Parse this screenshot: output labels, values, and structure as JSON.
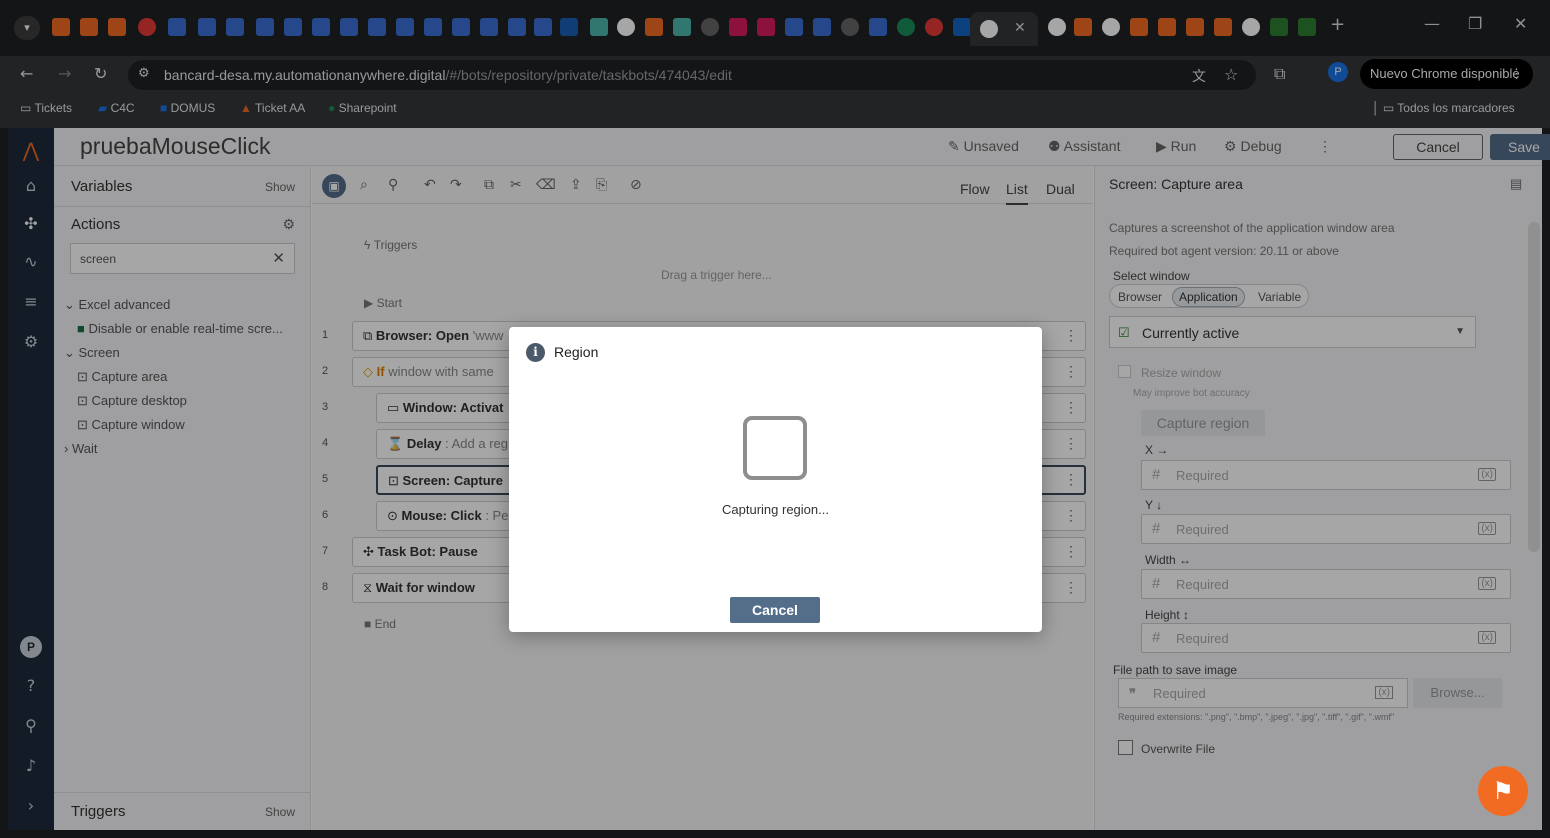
{
  "browser": {
    "url_host": "bancard-desa.my.automationanywhere.digital",
    "url_path": "/#/bots/repository/private/taskbots/474043/edit",
    "update_label": "Nuevo Chrome disponible",
    "bookmarks": [
      "Tickets",
      "C4C",
      "DOMUS",
      "Ticket AA",
      "Sharepoint"
    ],
    "all_bookmarks": "Todos los marcadores"
  },
  "header": {
    "title": "pruebaMouseClick",
    "unsaved": "Unsaved",
    "assistant": "Assistant",
    "run": "Run",
    "debug": "Debug",
    "cancel": "Cancel",
    "save": "Save"
  },
  "palette": {
    "variables": "Variables",
    "show": "Show",
    "actions": "Actions",
    "search_value": "screen",
    "tree": [
      "Excel advanced",
      "Disable or enable real-time scre...",
      "Screen",
      "Capture area",
      "Capture desktop",
      "Capture window",
      "Wait"
    ],
    "triggers": "Triggers"
  },
  "canvas": {
    "views": [
      "Flow",
      "List",
      "Dual"
    ],
    "triggers": "Triggers",
    "drag_hint": "Drag a trigger here...",
    "start": "Start",
    "end": "End",
    "steps": [
      {
        "n": "1",
        "title": "Browser: Open",
        "note": " 'www"
      },
      {
        "n": "2",
        "title": "If",
        "note": " window with same"
      },
      {
        "n": "3",
        "title": "Window: Activat",
        "note": ""
      },
      {
        "n": "4",
        "title": "Delay",
        "note": " : Add a reg"
      },
      {
        "n": "5",
        "title": "Screen: Capture",
        "note": ""
      },
      {
        "n": "6",
        "title": "Mouse: Click",
        "note": " : Pe"
      },
      {
        "n": "7",
        "title": "Task Bot: Pause",
        "note": ""
      },
      {
        "n": "8",
        "title": "Wait for window",
        "note": ""
      }
    ]
  },
  "props": {
    "title": "Screen: Capture area",
    "desc": "Captures a screenshot of the application window area",
    "version": "Required bot agent version: 20.11 or above",
    "select_window": "Select window",
    "window_tabs": [
      "Browser",
      "Application",
      "Variable"
    ],
    "window_value": "Currently active",
    "resize": "Resize window",
    "resize_hint": "May improve bot accuracy",
    "capture_region": "Capture region",
    "x_label": "X →",
    "y_label": "Y ↓",
    "width_label": "Width ↔",
    "height_label": "Height ↕",
    "required": "Required",
    "var_icon": "(x)",
    "file_label": "File path to save image",
    "browse": "Browse...",
    "ext_hint": "Required extensions: \".png\", \".bmp\", \".jpeg\", \".jpg\", \".tiff\", \".gif\", \".wmf\"",
    "overwrite": "Overwrite File"
  },
  "dialog": {
    "title": "Region",
    "message": "Capturing region...",
    "cancel": "Cancel"
  },
  "rail": {
    "avatar": "P"
  }
}
